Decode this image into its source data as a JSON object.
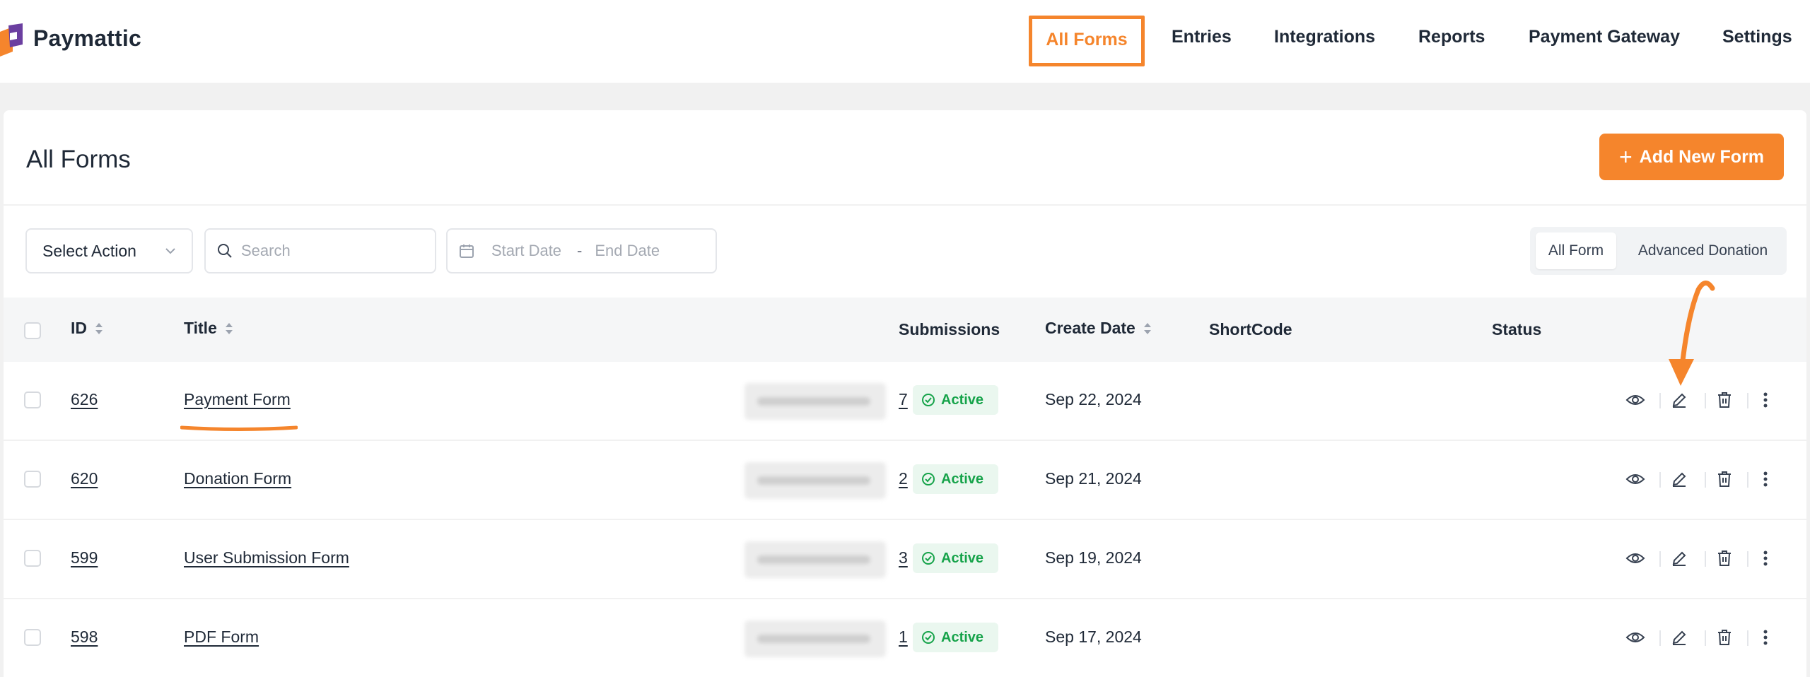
{
  "app": {
    "brand": "Paymattic"
  },
  "nav": {
    "items": [
      {
        "label": "All Forms",
        "active": true
      },
      {
        "label": "Entries"
      },
      {
        "label": "Integrations"
      },
      {
        "label": "Reports"
      },
      {
        "label": "Payment Gateway"
      },
      {
        "label": "Settings"
      }
    ]
  },
  "page": {
    "title": "All Forms",
    "add_button": "Add New Form",
    "select_action": "Select Action",
    "search_placeholder": "Search",
    "start_date_placeholder": "Start Date",
    "date_separator": "-",
    "end_date_placeholder": "End Date",
    "filter_tabs": [
      {
        "label": "All Form",
        "selected": true
      },
      {
        "label": "Advanced Donation"
      }
    ]
  },
  "table": {
    "columns": {
      "id": "ID",
      "title": "Title",
      "submissions": "Submissions",
      "create_date": "Create Date",
      "shortcode": "ShortCode",
      "status": "Status"
    },
    "rows": [
      {
        "id": "626",
        "title": "Payment Form",
        "submissions": "7",
        "date": "Sep 22, 2024",
        "status": "Active"
      },
      {
        "id": "620",
        "title": "Donation Form",
        "submissions": "2",
        "date": "Sep 21, 2024",
        "status": "Active"
      },
      {
        "id": "599",
        "title": "User Submission Form",
        "submissions": "3",
        "date": "Sep 19, 2024",
        "status": "Active"
      },
      {
        "id": "598",
        "title": "PDF Form",
        "submissions": "1",
        "date": "Sep 17, 2024",
        "status": "Active"
      }
    ]
  },
  "colors": {
    "accent": "#f5852c",
    "status_active": "#16a34a",
    "status_bg": "#eaf7ef"
  },
  "icons": [
    "logo-icon",
    "plus-icon",
    "chevron-down-icon",
    "search-icon",
    "calendar-icon",
    "sort-icon",
    "check-circle-icon",
    "eye-icon",
    "pencil-icon",
    "trash-icon",
    "more-vertical-icon"
  ]
}
